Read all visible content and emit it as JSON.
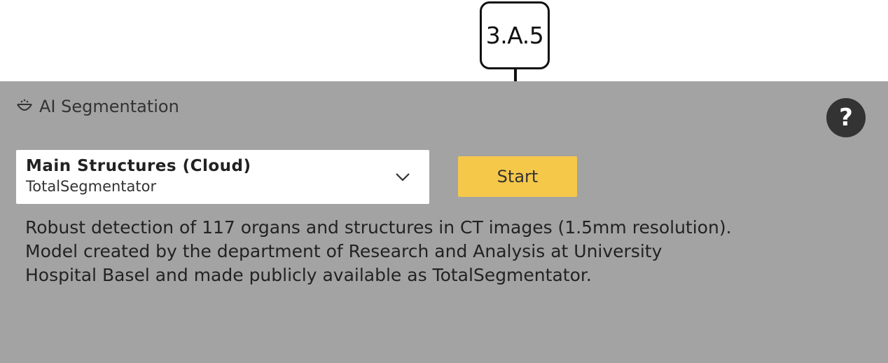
{
  "callout": {
    "label": "3.A.5"
  },
  "panel": {
    "title": "AI Segmentation",
    "title_icon": "ai-face-icon",
    "help_label": "?",
    "help_icon": "help-icon",
    "select": {
      "main_value": "Main Structures (Cloud)",
      "sub_value": "TotalSegmentator",
      "icon": "chevron-down-icon"
    },
    "start_label": "Start",
    "description": {
      "line1": "Robust detection of 117 organs and structures in CT images (1.5mm resolution).",
      "line2": "Model created by the department of Research and Analysis at University Hospital Basel and made publicly available as TotalSegmentator."
    }
  },
  "colors": {
    "panel_bg": "#a3a3a3",
    "accent": "#f6c84a",
    "help_bg": "#333333"
  }
}
